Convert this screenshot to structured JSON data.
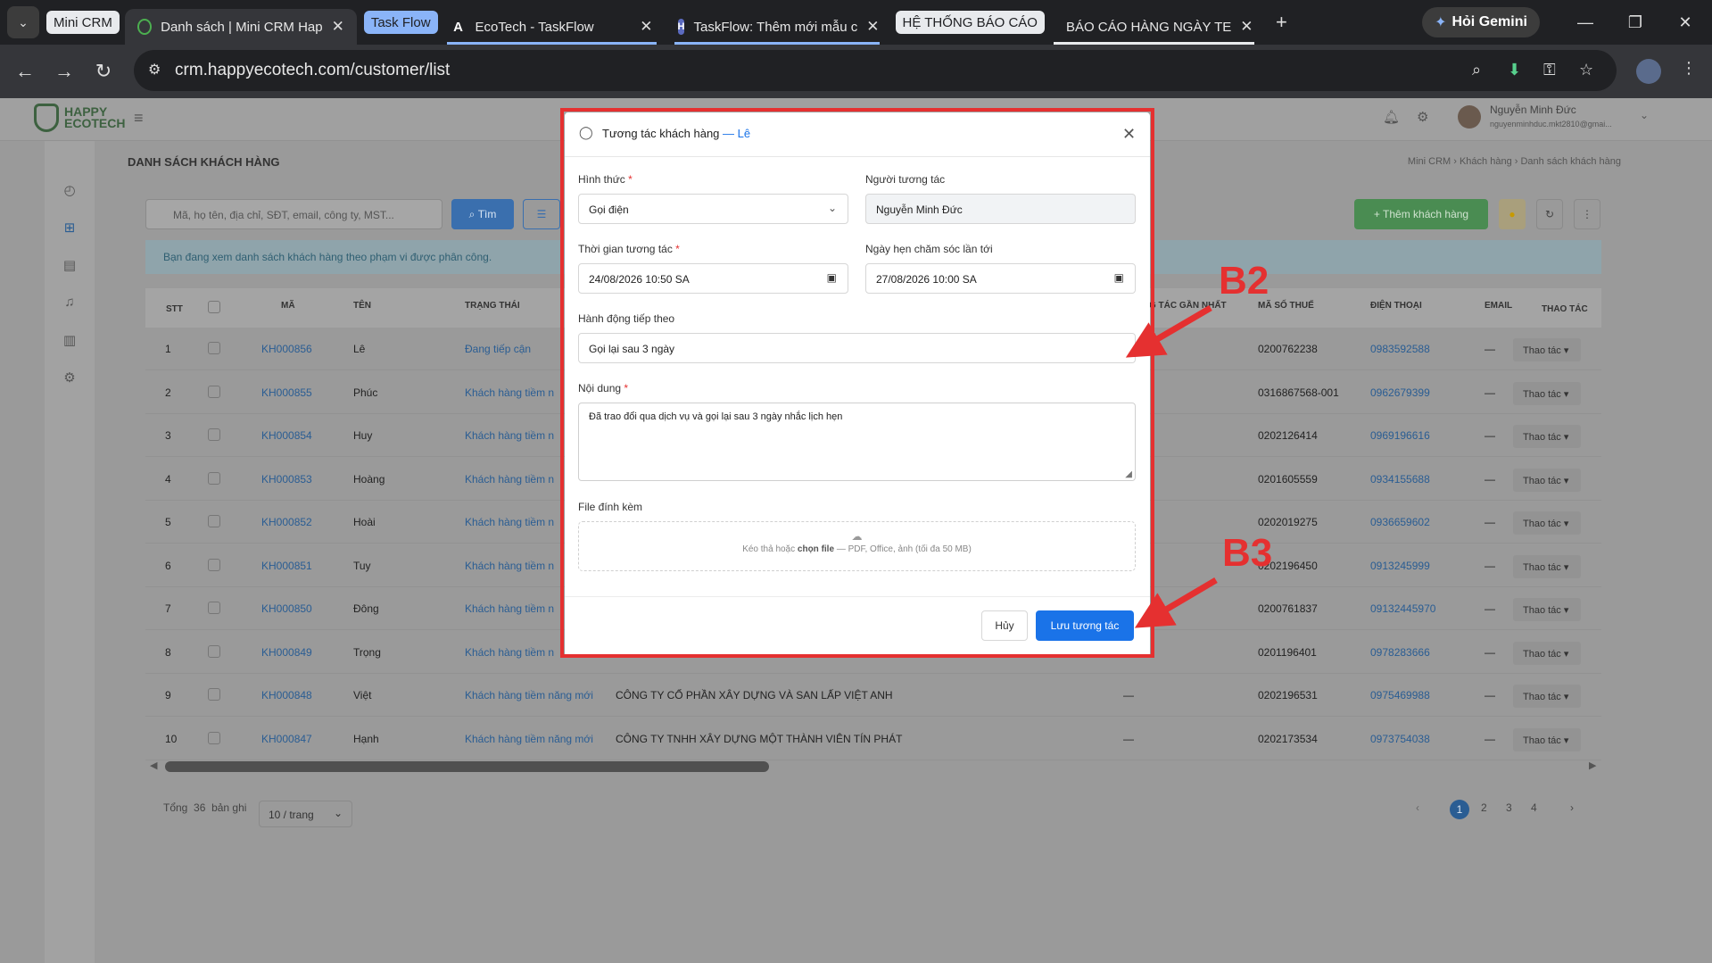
{
  "browser": {
    "groups": {
      "g1": "Mini CRM",
      "g2": "Task Flow",
      "g3": "HỆ THỐNG BÁO CÁO"
    },
    "tabs": [
      {
        "title": "Danh sách | Mini CRM Hap",
        "icon": "shield-icon"
      },
      {
        "title": "EcoTech - TaskFlow",
        "icon": "A"
      },
      {
        "title": "TaskFlow: Thêm mới mẫu c",
        "icon": "H"
      },
      {
        "title": "BÁO CÁO HÀNG NGÀY TE",
        "icon": "sheets-icon"
      }
    ],
    "gemini_label": "Hỏi Gemini",
    "url": "crm.happyecotech.com/customer/list"
  },
  "app": {
    "logo_line1": "HAPPY",
    "logo_line2": "ECOTECH",
    "user_name": "Nguyễn Minh Đức",
    "user_email": "nguyenminhduc.mkt2810@gmai...",
    "page_title": "DANH SÁCH KHÁCH HÀNG",
    "breadcrumb": [
      "Mini CRM",
      "Khách hàng",
      "Danh sách khách hàng"
    ],
    "search_placeholder": "Mã, họ tên, địa chỉ, SĐT, email, công ty, MST...",
    "search_button": "Tìm",
    "add_button": "+ Thêm khách hàng",
    "info_text": "Bạn đang xem danh sách khách hàng theo phạm vi được phân công.",
    "columns": {
      "stt": "STT",
      "ma": "MÃ",
      "ten": "TÊN",
      "trangthai": "TRẠNG THÁI",
      "gannhat": "G TÁC GẦN NHẤT",
      "mst": "MÃ SỐ THUẾ",
      "phone": "ĐIỆN THOẠI",
      "email": "EMAIL",
      "action": "THAO TÁC"
    },
    "rows": [
      {
        "stt": "1",
        "ma": "KH000856",
        "ten": "Lê",
        "tt": "Đang tiếp cận",
        "cty": "",
        "gn": "",
        "mst": "0200762238",
        "phone": "0983592588",
        "email": "—",
        "act": "Thao tác ▾"
      },
      {
        "stt": "2",
        "ma": "KH000855",
        "ten": "Phúc",
        "tt": "Khách hàng tiềm n",
        "cty": "",
        "gn": "",
        "mst": "0316867568-001",
        "phone": "0962679399",
        "email": "—",
        "act": "Thao tác ▾"
      },
      {
        "stt": "3",
        "ma": "KH000854",
        "ten": "Huy",
        "tt": "Khách hàng tiềm n",
        "cty": "",
        "gn": "",
        "mst": "0202126414",
        "phone": "0969196616",
        "email": "—",
        "act": "Thao tác ▾"
      },
      {
        "stt": "4",
        "ma": "KH000853",
        "ten": "Hoàng",
        "tt": "Khách hàng tiềm n",
        "cty": "",
        "gn": "",
        "mst": "0201605559",
        "phone": "0934155688",
        "email": "—",
        "act": "Thao tác ▾"
      },
      {
        "stt": "5",
        "ma": "KH000852",
        "ten": "Hoài",
        "tt": "Khách hàng tiềm n",
        "cty": "",
        "gn": "",
        "mst": "0202019275",
        "phone": "0936659602",
        "email": "—",
        "act": "Thao tác ▾"
      },
      {
        "stt": "6",
        "ma": "KH000851",
        "ten": "Tuy",
        "tt": "Khách hàng tiềm n",
        "cty": "",
        "gn": "",
        "mst": "0202196450",
        "phone": "0913245999",
        "email": "—",
        "act": "Thao tác ▾"
      },
      {
        "stt": "7",
        "ma": "KH000850",
        "ten": "Đông",
        "tt": "Khách hàng tiềm n",
        "cty": "",
        "gn": "",
        "mst": "0200761837",
        "phone": "09132445970",
        "email": "—",
        "act": "Thao tác ▾"
      },
      {
        "stt": "8",
        "ma": "KH000849",
        "ten": "Trọng",
        "tt": "Khách hàng tiềm n",
        "cty": "",
        "gn": "",
        "mst": "0201196401",
        "phone": "0978283666",
        "email": "—",
        "act": "Thao tác ▾"
      },
      {
        "stt": "9",
        "ma": "KH000848",
        "ten": "Việt",
        "tt": "Khách hàng tiềm năng mới",
        "cty": "CÔNG TY CỔ PHẦN XÂY DỰNG VÀ SAN LẤP VIỆT ANH",
        "gn": "—",
        "mst": "0202196531",
        "phone": "0975469988",
        "email": "—",
        "act": "Thao tác ▾"
      },
      {
        "stt": "10",
        "ma": "KH000847",
        "ten": "Hạnh",
        "tt": "Khách hàng tiềm năng mới",
        "cty": "CÔNG TY TNHH XÂY DỰNG MỘT THÀNH VIÊN TÍN PHÁT",
        "gn": "—",
        "mst": "0202173534",
        "phone": "0973754038",
        "email": "—",
        "act": "Thao tác ▾"
      }
    ],
    "total_label": "Tổng",
    "total_count": "36",
    "total_unit": "bản ghi",
    "page_size": "10 / trang",
    "pages": [
      "1",
      "2",
      "3",
      "4"
    ]
  },
  "modal": {
    "title": "Tương tác khách hàng",
    "customer": "— Lê",
    "hinhthuc_label": "Hình thức",
    "hinhthuc_value": "Gọi điện",
    "nguoi_label": "Người tương tác",
    "nguoi_value": "Nguyễn Minh Đức",
    "thoigian_label": "Thời gian tương tác",
    "thoigian_value": "24/08/2026 10:50 SA",
    "ngayhen_label": "Ngày hẹn chăm sóc lần tới",
    "ngayhen_value": "27/08/2026 10:00 SA",
    "hanhdong_label": "Hành động tiếp theo",
    "hanhdong_value": "Gọi lại sau 3 ngày",
    "noidung_label": "Nội dung",
    "noidung_value": "Đã trao đổi qua dịch vụ và gọi lại sau 3 ngày nhắc lịch hẹn",
    "file_label": "File đính kèm",
    "drop_text_a": "Kéo thả hoặc",
    "drop_text_b": "chọn file",
    "drop_text_c": "— PDF, Office, ảnh (tối đa 50 MB)",
    "cancel": "Hủy",
    "save": "Lưu tương tác"
  },
  "annotations": {
    "b2": "B2",
    "b3": "B3"
  },
  "colors": {
    "accent": "#1a73e8",
    "annotation": "#e53030",
    "add_button": "#4a8c52"
  }
}
